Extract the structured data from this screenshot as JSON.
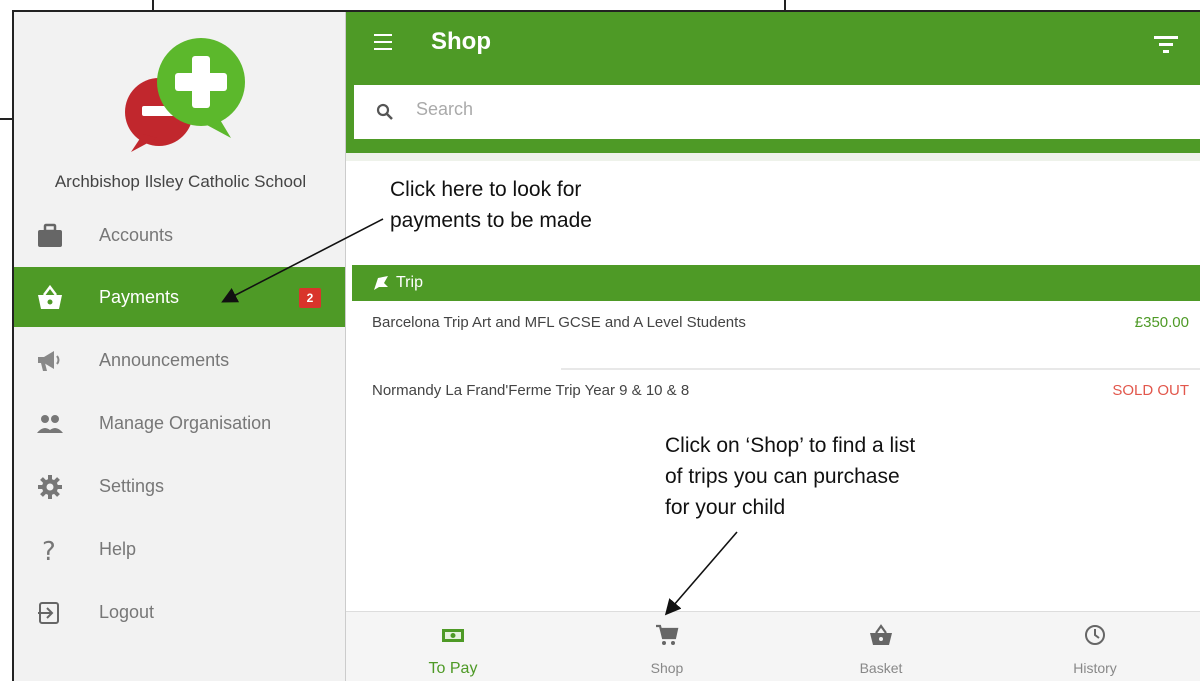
{
  "sidebar": {
    "org_name": "Archbishop Ilsley Catholic School",
    "items": [
      {
        "label": "Accounts",
        "icon": "briefcase-icon"
      },
      {
        "label": "Payments",
        "icon": "basket-icon",
        "badge": "2",
        "active": true
      },
      {
        "label": "Announcements",
        "icon": "megaphone-icon"
      },
      {
        "label": "Manage Organisation",
        "icon": "people-icon"
      },
      {
        "label": "Settings",
        "icon": "gear-icon"
      },
      {
        "label": "Help",
        "icon": "question-icon"
      },
      {
        "label": "Logout",
        "icon": "logout-icon"
      }
    ]
  },
  "header": {
    "title": "Shop"
  },
  "search": {
    "placeholder": "Search"
  },
  "category": {
    "label": "Trip",
    "items": [
      {
        "name": "Barcelona Trip Art and MFL GCSE and A Level Students",
        "price": "£350.00"
      },
      {
        "name": "Normandy La Frand'Ferme Trip Year 9 & 10 & 8",
        "price": "SOLD OUT"
      }
    ]
  },
  "bottom_nav": [
    {
      "label": "To Pay",
      "icon": "cash-icon",
      "active": true
    },
    {
      "label": "Shop",
      "icon": "cart-icon"
    },
    {
      "label": "Basket",
      "icon": "basket-icon"
    },
    {
      "label": "History",
      "icon": "clock-icon"
    }
  ],
  "annotations": {
    "payments_note_line1": "Click here to look for",
    "payments_note_line2": "payments to be made",
    "shop_note_line1": "Click on ‘Shop’ to find a list",
    "shop_note_line2": "of trips you can purchase",
    "shop_note_line3": "for your child"
  },
  "colors": {
    "brand_green": "#4e9a26",
    "badge_red": "#d9342b",
    "sold_out_red": "#e2574c",
    "logo_green": "#5cb82c",
    "logo_red": "#c1272d"
  }
}
